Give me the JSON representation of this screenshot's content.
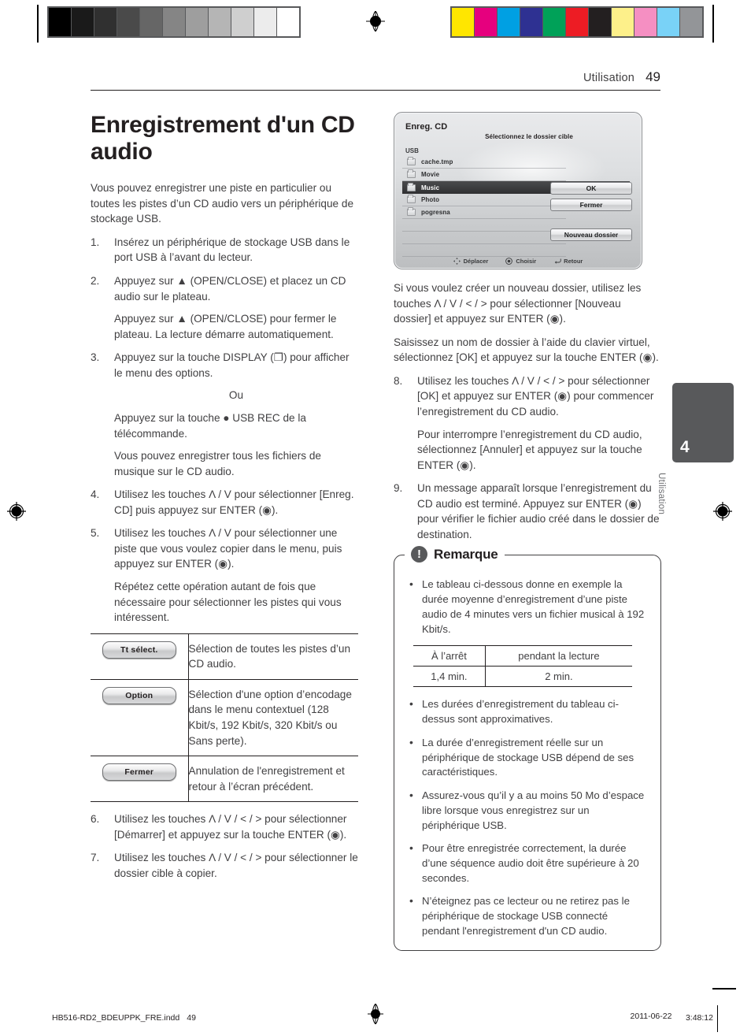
{
  "calibration": {
    "gray_steps": [
      "#000000",
      "#1a1a1a",
      "#303030",
      "#4a4a4a",
      "#666666",
      "#858585",
      "#9e9e9e",
      "#b5b5b5",
      "#cfcfcf",
      "#ececec",
      "#ffffff"
    ],
    "color_steps": [
      "#ffe600",
      "#e6007e",
      "#00a0e3",
      "#2e3192",
      "#00a158",
      "#ed1c24",
      "#231f20",
      "#fdf08a",
      "#f58fc2",
      "#79d2f7",
      "#939598"
    ]
  },
  "header": {
    "section": "Utilisation",
    "page_number": "49"
  },
  "left_column": {
    "title": "Enregistrement d'un CD audio",
    "intro": "Vous pouvez enregistrer une piste en particulier ou toutes les pistes d’un CD audio vers un périphérique de stockage USB.",
    "steps": [
      {
        "num": "1.",
        "paragraphs": [
          "Insérez un périphérique de stockage USB dans le port USB à l’avant du lecteur."
        ]
      },
      {
        "num": "2.",
        "paragraphs": [
          "Appuyez sur ▲ (OPEN/CLOSE) et placez un CD audio sur le plateau.",
          "Appuyez sur ▲ (OPEN/CLOSE) pour fermer le plateau. La lecture démarre automatiquement."
        ]
      },
      {
        "num": "3.",
        "paragraphs": [
          "Appuyez sur la touche DISPLAY (❐) pour afficher le menu des options.",
          "Ou",
          "Appuyez sur la touche ● USB REC de la télécommande.",
          "Vous pouvez enregistrer tous les fichiers de musique sur le CD audio."
        ]
      },
      {
        "num": "4.",
        "paragraphs": [
          "Utilisez les touches Λ / V pour sélectionner [Enreg. CD] puis appuyez sur ENTER (◉)."
        ]
      },
      {
        "num": "5.",
        "paragraphs": [
          "Utilisez les touches Λ / V pour sélectionner une piste que vous voulez copier dans le menu, puis appuyez sur ENTER (◉).",
          "Répétez cette opération autant de fois que nécessaire pour sélectionner les pistes qui vous intéressent."
        ]
      }
    ],
    "button_table": [
      {
        "button": "Tt sélect.",
        "description": "Sélection de toutes les pistes d’un CD audio."
      },
      {
        "button": "Option",
        "description": "Sélection d'une option d’encodage dans le menu contextuel (128 Kbit/s, 192 Kbit/s, 320 Kbit/s ou Sans perte)."
      },
      {
        "button": "Fermer",
        "description": "Annulation de l'enregistrement et retour à l’écran précédent."
      }
    ],
    "steps_after_table": [
      {
        "num": "6.",
        "paragraphs": [
          "Utilisez les touches Λ / V / < / > pour sélectionner [Démarrer] et appuyez sur la touche ENTER (◉)."
        ]
      },
      {
        "num": "7.",
        "paragraphs": [
          "Utilisez les touches Λ / V / < / > pour sélectionner le dossier cible à copier."
        ]
      }
    ]
  },
  "screenshot_mock": {
    "title": "Enreg. CD",
    "subtitle": "Sélectionnez le dossier cible",
    "source_label": "USB",
    "files": [
      {
        "name": "cache.tmp",
        "selected": false
      },
      {
        "name": "Movie",
        "selected": false
      },
      {
        "name": "Music",
        "selected": true
      },
      {
        "name": "Photo",
        "selected": false
      },
      {
        "name": "pogresna",
        "selected": false
      }
    ],
    "buttons": [
      {
        "label": "OK"
      },
      {
        "label": "Fermer"
      },
      {
        "label": "Nouveau dossier"
      }
    ],
    "footer_hints": [
      {
        "icon": "dpad-icon",
        "label": "Déplacer"
      },
      {
        "icon": "enter-icon",
        "label": "Choisir"
      },
      {
        "icon": "return-icon",
        "label": "Retour"
      }
    ]
  },
  "right_column": {
    "paragraphs_top": [
      "Si vous voulez créer un nouveau dossier, utilisez les touches Λ / V / < / > pour sélectionner [Nouveau dossier] et appuyez sur ENTER (◉).",
      "Saisissez un nom de dossier à l’aide du clavier virtuel, sélectionnez [OK] et appuyez sur la touche ENTER (◉)."
    ],
    "steps": [
      {
        "num": "8.",
        "paragraphs": [
          "Utilisez les touches Λ / V / < / > pour sélectionner [OK] et appuyez sur ENTER (◉) pour commencer l’enregistrement du CD audio.",
          "Pour interrompre l’enregistrement du CD audio, sélectionnez [Annuler] et appuyez sur la touche ENTER (◉)."
        ]
      },
      {
        "num": "9.",
        "paragraphs": [
          "Un message apparaît lorsque l’enregistrement du CD audio est terminé. Appuyez sur ENTER (◉) pour vérifier le fichier audio créé dans le dossier de destination."
        ]
      }
    ],
    "note": {
      "badge": "!",
      "title": "Remarque",
      "bullets_before_table": [
        "Le tableau ci-dessous donne en exemple la durée moyenne d’enregistrement d’une piste audio de 4 minutes vers un fichier musical à 192 Kbit/s."
      ],
      "table": {
        "headers": [
          "À l’arrêt",
          "pendant la lecture"
        ],
        "rows": [
          [
            "1,4 min.",
            "2 min."
          ]
        ]
      },
      "bullets_after_table": [
        "Les durées d’enregistrement du tableau ci-dessus sont approximatives.",
        "La durée d’enregistrement réelle sur un périphérique de stockage USB dépend de ses caractéristiques.",
        "Assurez-vous qu’il y a au moins 50 Mo d’espace libre lorsque vous enregistrez sur un périphérique USB.",
        "Pour être enregistrée correctement, la durée d’une séquence audio doit être supérieure à 20 secondes.",
        "N’éteignez pas ce lecteur ou ne retirez pas le périphérique de stockage USB connecté pendant l'enregistrement d'un CD audio."
      ]
    }
  },
  "chapter_tab": {
    "number": "4",
    "label": "Utilisation"
  },
  "footer": {
    "filename": "HB516-RD2_BDEUPPK_FRE.indd",
    "page": "49",
    "date": "2011-06-22",
    "time_prefix": "　",
    "time": "3:48:12"
  }
}
